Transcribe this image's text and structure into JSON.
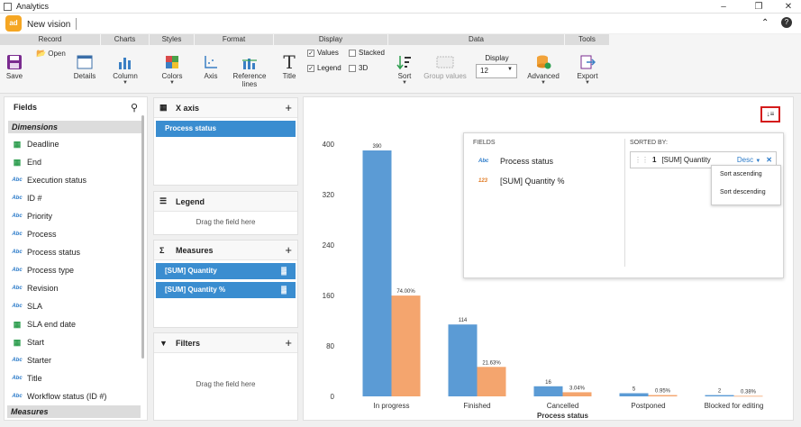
{
  "window": {
    "title": "Analytics",
    "logo_text": "ad",
    "doc_title": "New vision",
    "collapse_icon": "double-chevron-up-icon",
    "help_icon": "help-icon"
  },
  "ribbon": {
    "groups": {
      "record": "Record",
      "charts": "Charts",
      "styles": "Styles",
      "format": "Format",
      "display": "Display",
      "data": "Data",
      "tools": "Tools"
    },
    "save": "Save",
    "open": "Open",
    "details": "Details",
    "column": "Column",
    "colors": "Colors",
    "axis": "Axis",
    "reference_lines_1": "Reference",
    "reference_lines_2": "lines",
    "title": "Title",
    "values": "Values",
    "stacked": "Stacked",
    "legend": "Legend",
    "three_d": "3D",
    "sort": "Sort",
    "group_values": "Group values",
    "display_label": "Display",
    "display_value": "12",
    "advanced": "Advanced",
    "export": "Export"
  },
  "fields": {
    "title": "Fields",
    "dimensions_label": "Dimensions",
    "measures_label": "Measures",
    "items": [
      {
        "label": "Deadline",
        "type": "date"
      },
      {
        "label": "End",
        "type": "date"
      },
      {
        "label": "Execution status",
        "type": "text"
      },
      {
        "label": "ID #",
        "type": "text"
      },
      {
        "label": "Priority",
        "type": "text"
      },
      {
        "label": "Process",
        "type": "text"
      },
      {
        "label": "Process status",
        "type": "text"
      },
      {
        "label": "Process type",
        "type": "text"
      },
      {
        "label": "Revision",
        "type": "text"
      },
      {
        "label": "SLA",
        "type": "text"
      },
      {
        "label": "SLA end date",
        "type": "date"
      },
      {
        "label": "Start",
        "type": "date"
      },
      {
        "label": "Starter",
        "type": "text"
      },
      {
        "label": "Title",
        "type": "text"
      },
      {
        "label": "Workflow status (ID #)",
        "type": "text"
      }
    ],
    "type_icons": {
      "text": "Abc",
      "number": "123"
    }
  },
  "zones": {
    "x_axis": {
      "title": "X axis",
      "item": "Process status"
    },
    "legend": {
      "title": "Legend",
      "hint": "Drag the field here"
    },
    "measures": {
      "title": "Measures",
      "items": [
        "[SUM] Quantity",
        "[SUM] Quantity %"
      ]
    },
    "filters": {
      "title": "Filters",
      "hint": "Drag the field here"
    }
  },
  "sort_popup": {
    "fields_header": "FIELDS",
    "sorted_by_header": "SORTED BY:",
    "fields": [
      {
        "label": "Process status",
        "icon": "Abc"
      },
      {
        "label": "[SUM] Quantity %",
        "icon": "123"
      }
    ],
    "sorted": {
      "index": "1",
      "label": "[SUM] Quantity",
      "direction": "Desc"
    },
    "menu": [
      "Sort ascending",
      "Sort descending"
    ]
  },
  "chart_data": {
    "type": "bar",
    "xlabel": "Process status",
    "ylabel": "",
    "ylim": [
      0,
      400
    ],
    "yticks": [
      0,
      80,
      160,
      240,
      320,
      400
    ],
    "categories": [
      "In progress",
      "Finished",
      "Cancelled",
      "Postponed",
      "Blocked for editing"
    ],
    "series": [
      {
        "name": "[SUM] Quantity",
        "values": [
          390,
          114,
          16,
          5,
          2
        ],
        "labels": [
          "390",
          "114",
          "16",
          "5",
          "2"
        ],
        "color": "#5b9bd5"
      },
      {
        "name": "[SUM] Quantity %",
        "values": [
          74.0,
          21.63,
          3.04,
          0.95,
          0.38
        ],
        "labels": [
          "74.00%",
          "21.63%",
          "3.04%",
          "0.95%",
          "0.38%"
        ],
        "color": "#f4a56e"
      }
    ],
    "legend": "none",
    "grid": false
  }
}
